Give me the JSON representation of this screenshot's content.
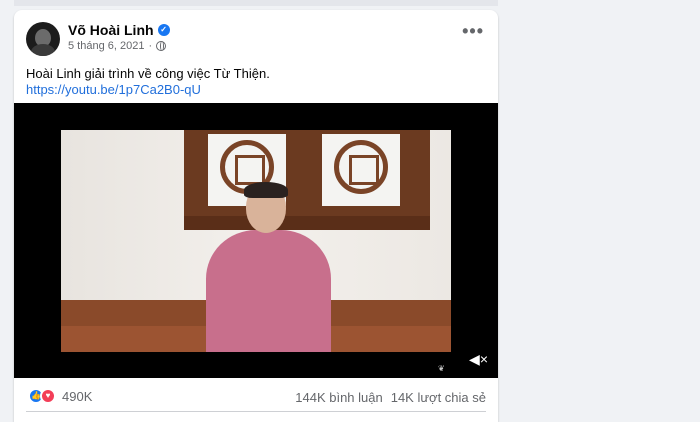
{
  "post": {
    "author": "Võ Hoài Linh",
    "timestamp": "5 tháng 6, 2021",
    "separator": "·",
    "text": "Hoài Linh giải trình về công việc Từ Thiện.",
    "link": "https://youtu.be/1p7Ca2B0-qU",
    "more_label": "•••"
  },
  "stats": {
    "reactions_count": "490K",
    "comments": "144K bình luận",
    "shares": "14K lượt chia sẻ"
  },
  "icons": {
    "verified": "verified-badge-icon",
    "privacy": "globe-icon",
    "like": "like-reaction-icon",
    "love": "love-reaction-icon",
    "volume": "volume-icon"
  },
  "colors": {
    "link": "#216fdb",
    "like": "#1877f2",
    "love": "#f33e58",
    "page_bg": "#f0f2f5"
  }
}
